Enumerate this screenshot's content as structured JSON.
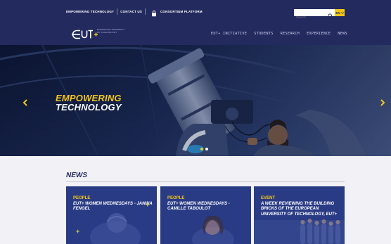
{
  "topbar": {
    "links": [
      "EMPOWERING TECHNOLOGY",
      "CONTACT US",
      "CONSORTIUM PLATFORM"
    ],
    "search_placeholder": "Search",
    "language": "EN"
  },
  "header": {
    "logo_text": "EUT+",
    "logo_subtext": "EUROPEAN UNIVERSITY OF TECHNOLOGY",
    "nav": [
      "EUT+ INITIATIVE",
      "STUDENTS",
      "RESEARCH",
      "EXPERIENCE",
      "NEWS"
    ]
  },
  "hero": {
    "title_line1": "EMPOWERING",
    "title_line2": "TECHNOLOGY",
    "slide_count": 2,
    "active_slide": 1
  },
  "news": {
    "heading": "NEWS",
    "cards": [
      {
        "category": "PEOPLE",
        "title": "EUT+ WOMEN WEDNESDAYS - JANINA FENGEL"
      },
      {
        "category": "PEOPLE",
        "title": "EUT+ WOMEN WEDNESDAYS - CAMILLE TABOULOT"
      },
      {
        "category": "EVENT",
        "title": "A WEEK REVIEWING THE BUILDING BRICKS OF THE EUROPEAN UNIVERSITY OF TECHNOLOGY, EUT+"
      }
    ]
  },
  "colors": {
    "navy": "#232a5e",
    "accent_yellow": "#f2c618",
    "card_blue": "#2a3b85",
    "page_bg": "#f2f2f6"
  },
  "icons": {
    "lock": "lock-icon",
    "search": "search-icon",
    "language_dropdown": "chevron-down-icon",
    "slider_prev": "chevron-left-icon",
    "slider_next": "chevron-right-icon"
  }
}
